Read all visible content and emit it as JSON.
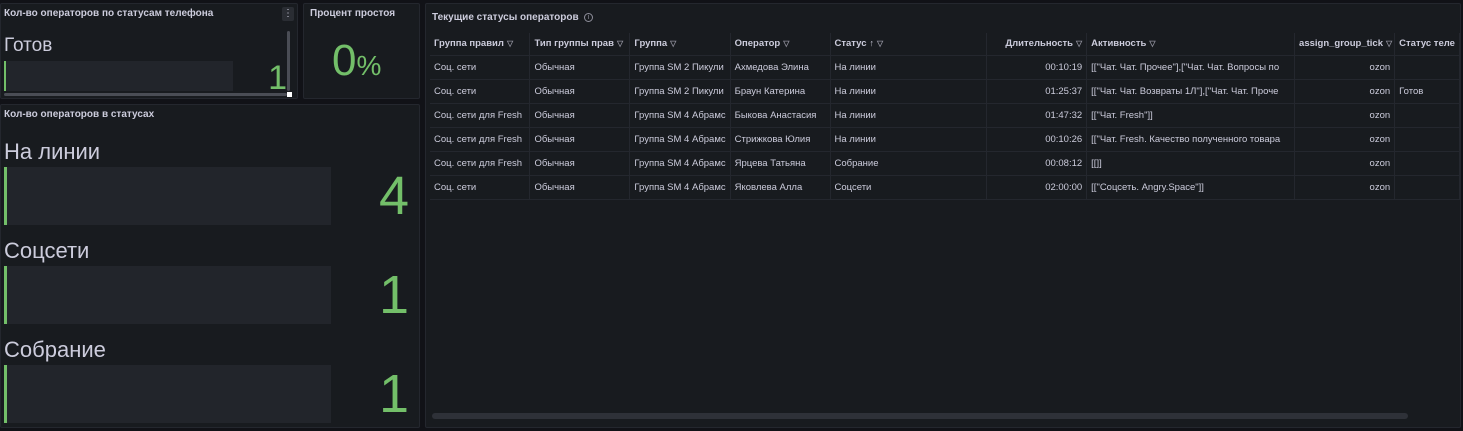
{
  "panels": {
    "phone_status": {
      "title": "Кол-во операторов по статусам телефона",
      "menu_icon": "more-vertical-icon",
      "label": "Готов",
      "value": "1"
    },
    "idle_percent": {
      "title": "Процент простоя",
      "value": "0",
      "unit": "%"
    },
    "operators_in_status": {
      "title": "Кол-во операторов в статусах",
      "items": [
        {
          "label": "На линии",
          "value": "4"
        },
        {
          "label": "Соцсети",
          "value": "1"
        },
        {
          "label": "Собрание",
          "value": "1"
        }
      ]
    },
    "current_statuses": {
      "title": "Текущие статусы операторов",
      "info_icon": "info-icon",
      "columns": [
        "Группа правил",
        "Тип группы прав",
        "Группа",
        "Оператор",
        "Статус",
        "Длительность",
        "Активность",
        "assign_group_tick",
        "Статус теле"
      ],
      "rows": [
        [
          "Соц. сети",
          "Обычная",
          "Группа SM 2 Пикули",
          "Ахмедова Элина",
          "На линии",
          "00:10:19",
          "[[\"Чат. Чат. Прочее\"],[\"Чат. Чат. Вопросы по",
          "ozon",
          ""
        ],
        [
          "Соц. сети",
          "Обычная",
          "Группа SM 2 Пикули",
          "Браун Катерина",
          "На линии",
          "01:25:37",
          "[[\"Чат. Чат. Возвраты 1Л\"],[\"Чат. Чат. Проче",
          "ozon",
          "Готов"
        ],
        [
          "Соц. сети для Fresh",
          "Обычная",
          "Группа SM 4 Абрамс",
          "Быкова Анастасия",
          "На линии",
          "01:47:32",
          "[[\"Чат. Fresh\"]]",
          "ozon",
          ""
        ],
        [
          "Соц. сети для Fresh",
          "Обычная",
          "Группа SM 4 Абрамс",
          "Стрижкова Юлия",
          "На линии",
          "00:10:26",
          "[[\"Чат. Fresh. Качество полученного товара",
          "ozon",
          ""
        ],
        [
          "Соц. сети для Fresh",
          "Обычная",
          "Группа SM 4 Абрамс",
          "Ярцева Татьяна",
          "Собрание",
          "00:08:12",
          "[[]]",
          "ozon",
          ""
        ],
        [
          "Соц. сети",
          "Обычная",
          "Группа SM 4 Абрамс",
          "Яковлева Алла",
          "Соцсети",
          "02:00:00",
          "[[\"Соцсеть. Angry.Space\"]]",
          "ozon",
          ""
        ]
      ],
      "sorted_column": "Статус",
      "sort_direction": "asc"
    }
  },
  "colors": {
    "background": "#111217",
    "panel": "#181b1f",
    "accent_green": "#73bf69"
  }
}
